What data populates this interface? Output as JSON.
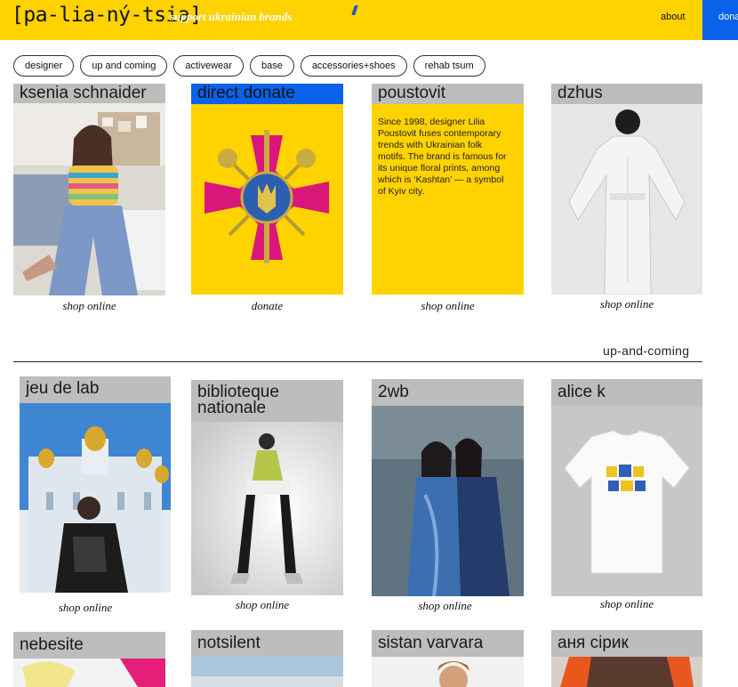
{
  "header": {
    "logo": "[pa-lia-ný-tsia]",
    "tagline": "support ukrainian brands",
    "nav_about": "about",
    "nav_donate": "donate"
  },
  "filters": [
    "designer",
    "up and coming",
    "activewear",
    "base",
    "accessories+shoes",
    "rehab tsum"
  ],
  "row1": [
    {
      "title": "ksenia schnaider",
      "caption": "shop online"
    },
    {
      "title": "direct donate",
      "caption": "donate"
    },
    {
      "title": "poustovit",
      "caption": "shop online",
      "description": "Since 1998, designer Lilia Poustovit fuses contemporary trends with Ukrainian folk motifs. The brand is famous for its unique floral prints, among which is ‘Kashtan’ — a symbol of Kyiv city."
    },
    {
      "title": "dzhus",
      "caption": "shop online"
    }
  ],
  "section": {
    "label": "up-and-coming"
  },
  "row2": [
    {
      "title": "jeu de lab",
      "caption": "shop online"
    },
    {
      "title": "biblioteque nationale",
      "caption": "shop online"
    },
    {
      "title": "2wb",
      "caption": "shop online"
    },
    {
      "title": "alice k",
      "caption": "shop online"
    }
  ],
  "row3": [
    {
      "title": "nebesite"
    },
    {
      "title": "notsilent"
    },
    {
      "title": "sistan varvara"
    },
    {
      "title": "аня сірик"
    }
  ],
  "colors": {
    "brand_yellow": "#ffd200",
    "donate_blue": "#0a62ea",
    "title_gray": "#bdbdbd"
  }
}
